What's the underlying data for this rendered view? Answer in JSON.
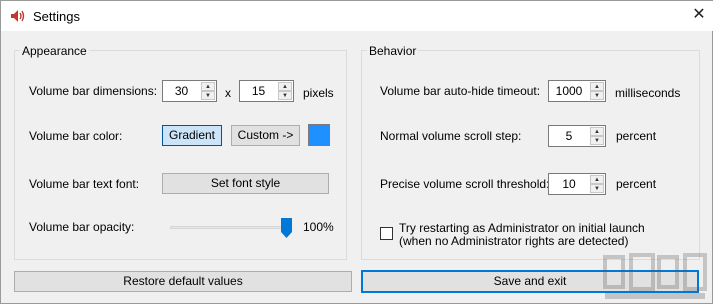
{
  "window": {
    "title": "Settings",
    "icon": "speaker-icon",
    "close_glyph": "✕"
  },
  "appearance": {
    "group_label": "Appearance",
    "dimensions": {
      "label": "Volume bar dimensions:",
      "width": "30",
      "separator": "x",
      "height": "15",
      "unit": "pixels"
    },
    "color": {
      "label": "Volume bar color:",
      "gradient_button": "Gradient",
      "custom_button": "Custom ->",
      "swatch_color": "#1e90ff",
      "gradient_selected": true
    },
    "font": {
      "label": "Volume bar text font:",
      "button": "Set font style"
    },
    "opacity": {
      "label": "Volume bar opacity:",
      "value": 1.0,
      "value_text": "100%"
    }
  },
  "behavior": {
    "group_label": "Behavior",
    "autohide": {
      "label": "Volume bar auto-hide timeout:",
      "value": "1000",
      "unit": "milliseconds"
    },
    "scroll_step": {
      "label": "Normal volume scroll step:",
      "value": "5",
      "unit": "percent"
    },
    "precise_threshold": {
      "label": "Precise volume scroll threshold:",
      "value": "10",
      "unit": "percent"
    },
    "admin_restart": {
      "line1": "Try restarting as Administrator on initial launch",
      "line2": "(when no Administrator rights are detected)",
      "checked": false
    }
  },
  "footer": {
    "restore_button": "Restore default values",
    "save_button": "Save and exit"
  }
}
